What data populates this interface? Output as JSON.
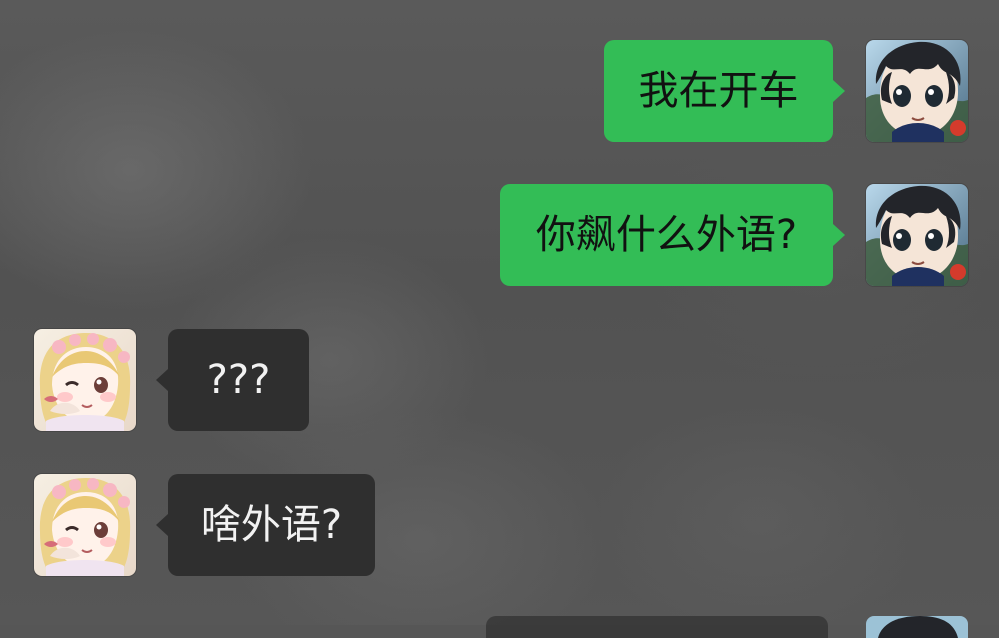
{
  "chat": {
    "messages": [
      {
        "sender": "self",
        "text": "我在开车",
        "avatar_icon": "boy-avatar"
      },
      {
        "sender": "self",
        "text": "你飙什么外语?",
        "avatar_icon": "boy-avatar"
      },
      {
        "sender": "other",
        "text": "???",
        "avatar_icon": "girl-avatar"
      },
      {
        "sender": "other",
        "text": "啥外语?",
        "avatar_icon": "girl-avatar"
      }
    ]
  },
  "colors": {
    "background": "#565656",
    "sent_bubble": "#33bd56",
    "received_bubble": "#2f2f2f",
    "sent_text": "#111111",
    "received_text": "#f2f2f2"
  }
}
